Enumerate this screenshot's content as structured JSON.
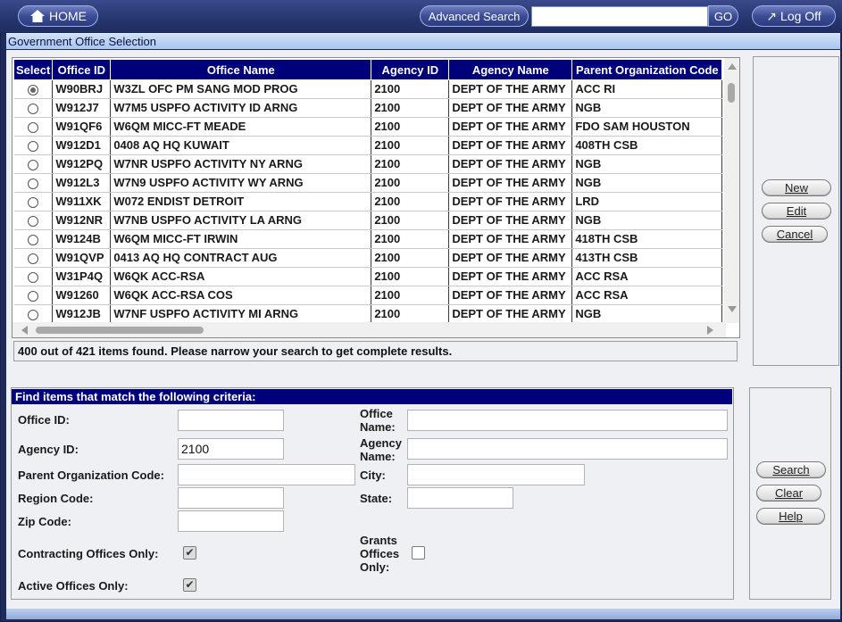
{
  "topbar": {
    "home_label": "HOME",
    "advanced_search_label": "Advanced Search",
    "search_placeholder": "",
    "go_label": "GO",
    "logoff_label": "Log Off"
  },
  "window_title": "Government Office Selection",
  "grid": {
    "columns": [
      "Select",
      "Office ID",
      "Office Name",
      "Agency ID",
      "Agency Name",
      "Parent Organization Code"
    ],
    "rows": [
      {
        "selected": true,
        "office_id": "W90BRJ",
        "office_name": "W3ZL OFC PM SANG MOD PROG",
        "agency_id": "2100",
        "agency_name": "DEPT OF THE ARMY",
        "parent_code": "ACC RI"
      },
      {
        "selected": false,
        "office_id": "W912J7",
        "office_name": "W7M5 USPFO ACTIVITY ID ARNG",
        "agency_id": "2100",
        "agency_name": "DEPT OF THE ARMY",
        "parent_code": "NGB"
      },
      {
        "selected": false,
        "office_id": "W91QF6",
        "office_name": "W6QM MICC-FT MEADE",
        "agency_id": "2100",
        "agency_name": "DEPT OF THE ARMY",
        "parent_code": "FDO SAM HOUSTON"
      },
      {
        "selected": false,
        "office_id": "W912D1",
        "office_name": "0408 AQ HQ KUWAIT",
        "agency_id": "2100",
        "agency_name": "DEPT OF THE ARMY",
        "parent_code": "408TH CSB"
      },
      {
        "selected": false,
        "office_id": "W912PQ",
        "office_name": "W7NR USPFO ACTIVITY NY ARNG",
        "agency_id": "2100",
        "agency_name": "DEPT OF THE ARMY",
        "parent_code": "NGB"
      },
      {
        "selected": false,
        "office_id": "W912L3",
        "office_name": "W7N9 USPFO ACTIVITY WY ARNG",
        "agency_id": "2100",
        "agency_name": "DEPT OF THE ARMY",
        "parent_code": "NGB"
      },
      {
        "selected": false,
        "office_id": "W911XK",
        "office_name": "W072 ENDIST DETROIT",
        "agency_id": "2100",
        "agency_name": "DEPT OF THE ARMY",
        "parent_code": "LRD"
      },
      {
        "selected": false,
        "office_id": "W912NR",
        "office_name": "W7NB USPFO ACTIVITY LA ARNG",
        "agency_id": "2100",
        "agency_name": "DEPT OF THE ARMY",
        "parent_code": "NGB"
      },
      {
        "selected": false,
        "office_id": "W9124B",
        "office_name": "W6QM MICC-FT IRWIN",
        "agency_id": "2100",
        "agency_name": "DEPT OF THE ARMY",
        "parent_code": "418TH CSB"
      },
      {
        "selected": false,
        "office_id": "W91QVP",
        "office_name": "0413 AQ HQ CONTRACT AUG",
        "agency_id": "2100",
        "agency_name": "DEPT OF THE ARMY",
        "parent_code": "413TH CSB"
      },
      {
        "selected": false,
        "office_id": "W31P4Q",
        "office_name": "W6QK ACC-RSA",
        "agency_id": "2100",
        "agency_name": "DEPT OF THE ARMY",
        "parent_code": "ACC RSA"
      },
      {
        "selected": false,
        "office_id": "W91260",
        "office_name": "W6QK ACC-RSA COS",
        "agency_id": "2100",
        "agency_name": "DEPT OF THE ARMY",
        "parent_code": "ACC RSA"
      },
      {
        "selected": false,
        "office_id": "W912JB",
        "office_name": "W7NF USPFO ACTIVITY MI ARNG",
        "agency_id": "2100",
        "agency_name": "DEPT OF THE ARMY",
        "parent_code": "NGB"
      }
    ]
  },
  "status_message": "400 out of 421 items found. Please narrow your search to get complete results.",
  "actions": {
    "new_label": "New",
    "edit_label": "Edit",
    "cancel_label": "Cancel"
  },
  "criteria": {
    "header": "Find items that match the following criteria:",
    "office_id_label": "Office ID:",
    "office_id_value": "",
    "office_name_label_1": "Office",
    "office_name_label_2": "Name:",
    "office_name_value": "",
    "agency_id_label": "Agency ID:",
    "agency_id_value": "2100",
    "agency_name_label_1": "Agency",
    "agency_name_label_2": "Name:",
    "agency_name_value": "",
    "parent_org_label": "Parent Organization Code:",
    "parent_org_value": "",
    "city_label": "City:",
    "city_value": "",
    "region_label": "Region Code:",
    "region_value": "",
    "state_label": "State:",
    "state_value": "",
    "zip_label": "Zip Code:",
    "zip_value": "",
    "contracting_label": "Contracting Offices Only:",
    "contracting_checked": true,
    "grants_label_1": "Grants",
    "grants_label_2": "Offices",
    "grants_label_3": "Only:",
    "grants_checked": false,
    "active_label": "Active Offices Only:",
    "active_checked": true
  },
  "search_actions": {
    "search_label": "Search",
    "clear_label": "Clear",
    "help_label": "Help"
  }
}
